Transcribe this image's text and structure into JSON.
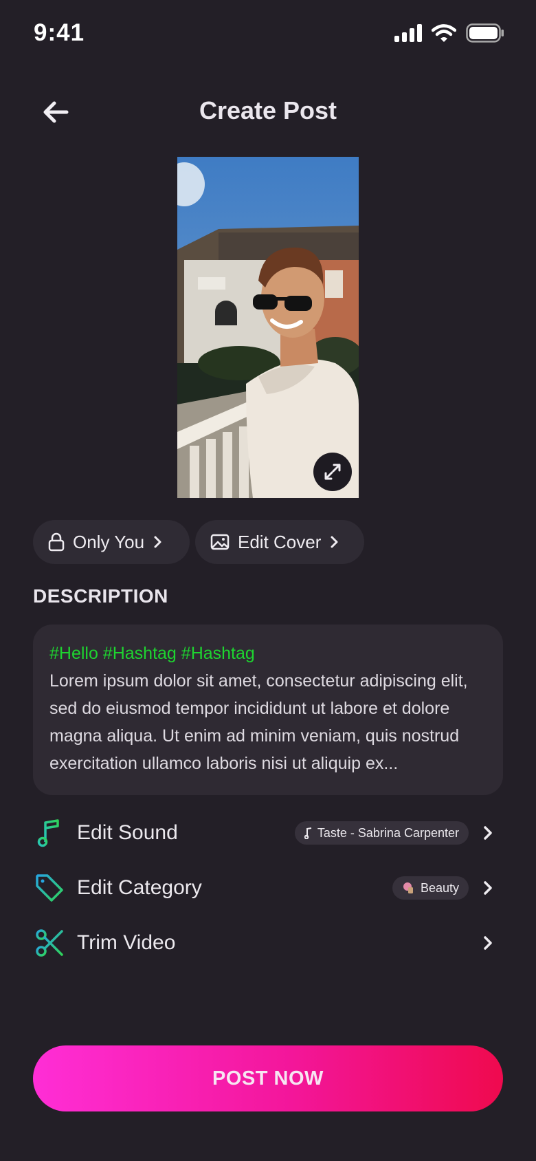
{
  "status_bar": {
    "time": "9:41"
  },
  "header": {
    "title": "Create Post"
  },
  "privacy_chip": {
    "label": "Only You"
  },
  "cover_chip": {
    "label": "Edit Cover"
  },
  "description": {
    "heading": "DESCRIPTION",
    "hashtags": "#Hello #Hashtag #Hashtag",
    "text": "Lorem ipsum dolor sit amet, consectetur adipiscing elit, sed do eiusmod tempor incididunt ut labore et dolore magna aliqua. Ut enim ad minim veniam, quis nostrud exercitation ullamco laboris nisi ut aliquip ex..."
  },
  "options": {
    "sound": {
      "label": "Edit Sound",
      "value": "Taste - Sabrina Carpenter",
      "icon": "music-note-icon"
    },
    "category": {
      "label": "Edit Category",
      "value": "Beauty",
      "icon": "tag-icon"
    },
    "trim": {
      "label": "Trim Video",
      "icon": "scissors-icon"
    }
  },
  "cta": {
    "label": "POST NOW"
  },
  "colors": {
    "background": "#231f27",
    "hashtag": "#1ed430",
    "cta_start": "#ff2ed6",
    "cta_end": "#ef0a4e",
    "icon_teal": "#27c4c2",
    "icon_green": "#2fd35a"
  }
}
